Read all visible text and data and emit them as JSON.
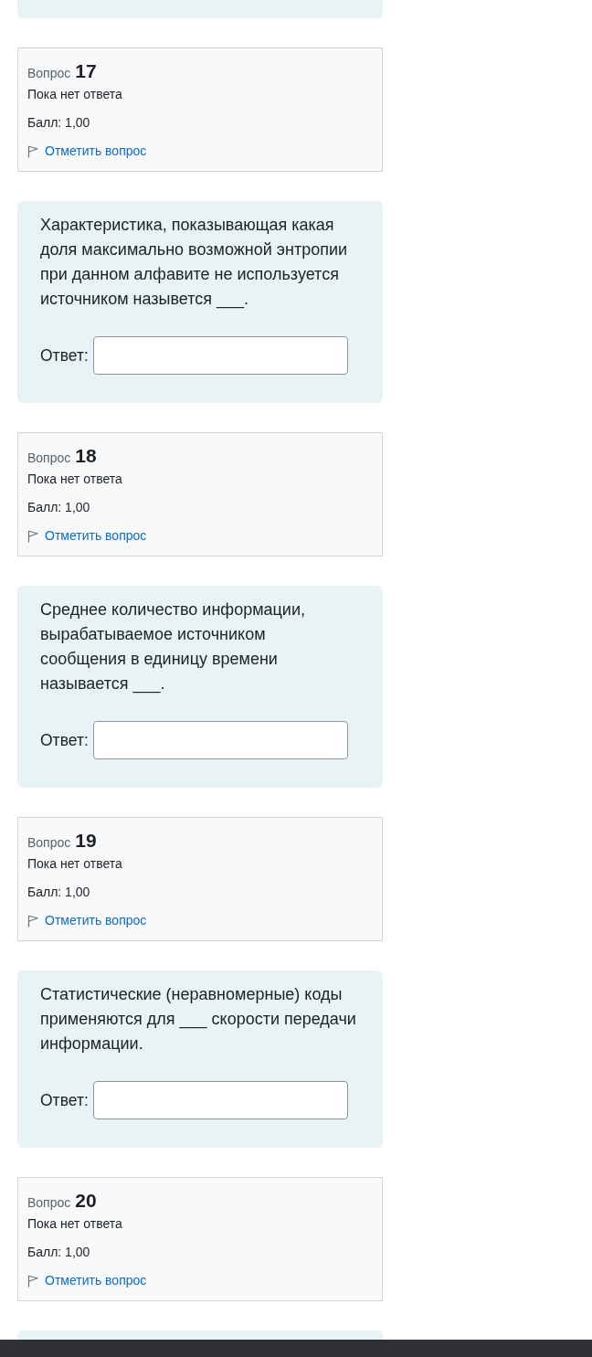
{
  "items": [
    {
      "kind": "info",
      "label": "Вопрос",
      "number": "17",
      "status": "Пока нет ответа",
      "grade": "Балл: 1,00",
      "flag_link": "Отметить вопрос",
      "flagged": false
    },
    {
      "kind": "prompt",
      "text_lines": [
        "Характеристика, показывающая какая",
        "доля максимально возможной энтропии",
        "при данном алфавите не используется",
        "источником назывется ___."
      ],
      "answer_label": "Ответ:"
    },
    {
      "kind": "info",
      "label": "Вопрос",
      "number": "18",
      "status": "Пока нет ответа",
      "grade": "Балл: 1,00",
      "flag_link": "Отметить вопрос",
      "flagged": false
    },
    {
      "kind": "prompt",
      "text_lines": [
        "Среднее количество информации,",
        "вырабатываемое источником",
        "сообщения в единицу времени",
        "называется ___."
      ],
      "answer_label": "Ответ:"
    },
    {
      "kind": "info",
      "label": "Вопрос",
      "number": "19",
      "status": "Пока нет ответа",
      "grade": "Балл: 1,00",
      "flag_link": "Отметить вопрос",
      "flagged": false
    },
    {
      "kind": "prompt",
      "text_lines": [
        "Статистические (неравномерные) коды",
        "применяются для ___ скорости передачи",
        "информации."
      ],
      "answer_label": "Ответ:"
    },
    {
      "kind": "info",
      "label": "Вопрос",
      "number": "20",
      "status": "Пока нет ответа",
      "grade": "Балл: 1,00",
      "flag_link": "Отметить вопрос",
      "flagged": false
    }
  ]
}
